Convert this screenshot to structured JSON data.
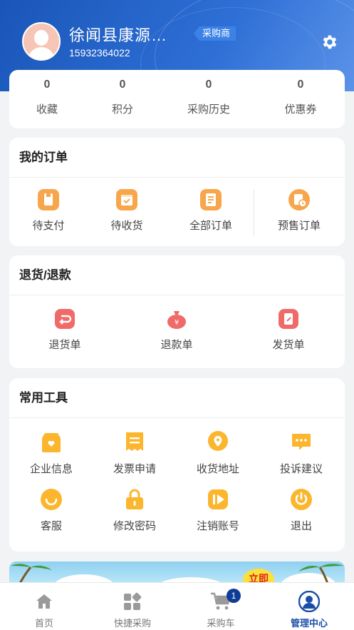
{
  "profile": {
    "name": "徐闻县康源…",
    "phone": "15932364022",
    "role": "采购商"
  },
  "stats": [
    {
      "value": "0",
      "label": "收藏"
    },
    {
      "value": "0",
      "label": "积分"
    },
    {
      "value": "0",
      "label": "采购历史"
    },
    {
      "value": "0",
      "label": "优惠券"
    }
  ],
  "orders": {
    "title": "我的订单",
    "items": [
      {
        "label": "待支付",
        "icon": "wallet-icon"
      },
      {
        "label": "待收货",
        "icon": "inbox-icon"
      },
      {
        "label": "全部订单",
        "icon": "order-list-icon"
      },
      {
        "label": "预售订单",
        "icon": "presale-clock-icon"
      }
    ]
  },
  "returns": {
    "title": "退货/退款",
    "items": [
      {
        "label": "退货单",
        "icon": "return-icon"
      },
      {
        "label": "退款单",
        "icon": "money-bag-icon"
      },
      {
        "label": "发货单",
        "icon": "shipping-doc-icon"
      }
    ]
  },
  "tools": {
    "title": "常用工具",
    "items": [
      {
        "label": "企业信息",
        "icon": "store-icon"
      },
      {
        "label": "发票申请",
        "icon": "invoice-icon"
      },
      {
        "label": "收货地址",
        "icon": "location-pin-icon"
      },
      {
        "label": "投诉建议",
        "icon": "feedback-icon"
      },
      {
        "label": "客服",
        "icon": "smile-icon"
      },
      {
        "label": "修改密码",
        "icon": "lock-icon"
      },
      {
        "label": "注销账号",
        "icon": "logout-account-icon"
      },
      {
        "label": "退出",
        "icon": "power-icon"
      }
    ]
  },
  "banner": {
    "tag": "立即"
  },
  "tabbar": {
    "items": [
      {
        "label": "首页",
        "icon": "home-icon"
      },
      {
        "label": "快捷采购",
        "icon": "grid-icon"
      },
      {
        "label": "采购车",
        "icon": "cart-icon",
        "badge": "1"
      },
      {
        "label": "管理中心",
        "icon": "user-icon"
      }
    ],
    "active": "管理中心"
  },
  "colors": {
    "header": "#1a56b8",
    "order_icon": "#f5a04a",
    "return_icon": "#f06a6a",
    "tool_icon": "#fbb62e",
    "active_tab": "#1a4fa8"
  }
}
